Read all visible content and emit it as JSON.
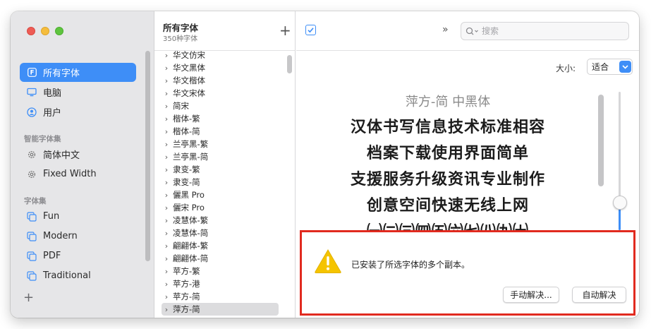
{
  "sidebar": {
    "top_items": [
      {
        "label": "所有字体",
        "icon": "font-book-icon",
        "selected": true
      },
      {
        "label": "电脑",
        "icon": "computer-icon"
      },
      {
        "label": "用户",
        "icon": "user-icon"
      }
    ],
    "smart_section": "智能字体集",
    "smart_items": [
      {
        "label": "简体中文",
        "icon": "gear-icon"
      },
      {
        "label": "Fixed Width",
        "icon": "gear-icon"
      }
    ],
    "collection_section": "字体集",
    "collections": [
      {
        "label": "Fun",
        "icon": "collection-icon"
      },
      {
        "label": "Modern",
        "icon": "collection-icon"
      },
      {
        "label": "PDF",
        "icon": "collection-icon"
      },
      {
        "label": "Traditional",
        "icon": "collection-icon"
      }
    ],
    "add_label": "+"
  },
  "list": {
    "title": "所有字体",
    "subtitle": "350种字体",
    "add_label": "+",
    "fonts": [
      "华文仿宋",
      "华文黑体",
      "华文楷体",
      "华文宋体",
      "简宋",
      "楷体-繁",
      "楷体-简",
      "兰亭黑-繁",
      "兰亭黑-简",
      "隶变-繁",
      "隶变-简",
      "儷黑 Pro",
      "儷宋 Pro",
      "凌慧体-繁",
      "凌慧体-简",
      "翩翩体-繁",
      "翩翩体-简",
      "苹方-繁",
      "苹方-港",
      "苹方-简",
      "萍方-简"
    ],
    "selected_index": 20
  },
  "toolbar": {
    "overflow_label": "»",
    "search_placeholder": "搜索"
  },
  "preview": {
    "size_label": "大小:",
    "size_value": "适合",
    "font_title": "萍方-简 中黑体",
    "lines": [
      "汉体书写信息技术标准相容",
      "档案下载使用界面简单",
      "支援服务升级资讯专业制作",
      "创意空间快速无线上网",
      "㈠㈡㈢㈣㈤㈥㈦㈧㈨㈩"
    ],
    "slider_value": 0.25
  },
  "alert": {
    "message": "已安装了所选字体的多个副本。",
    "manual_button": "手动解决...",
    "auto_button": "自动解决"
  },
  "colors": {
    "accent": "#3e8ef7",
    "alert_border": "#e12a1f",
    "warning": "#f5c400"
  }
}
